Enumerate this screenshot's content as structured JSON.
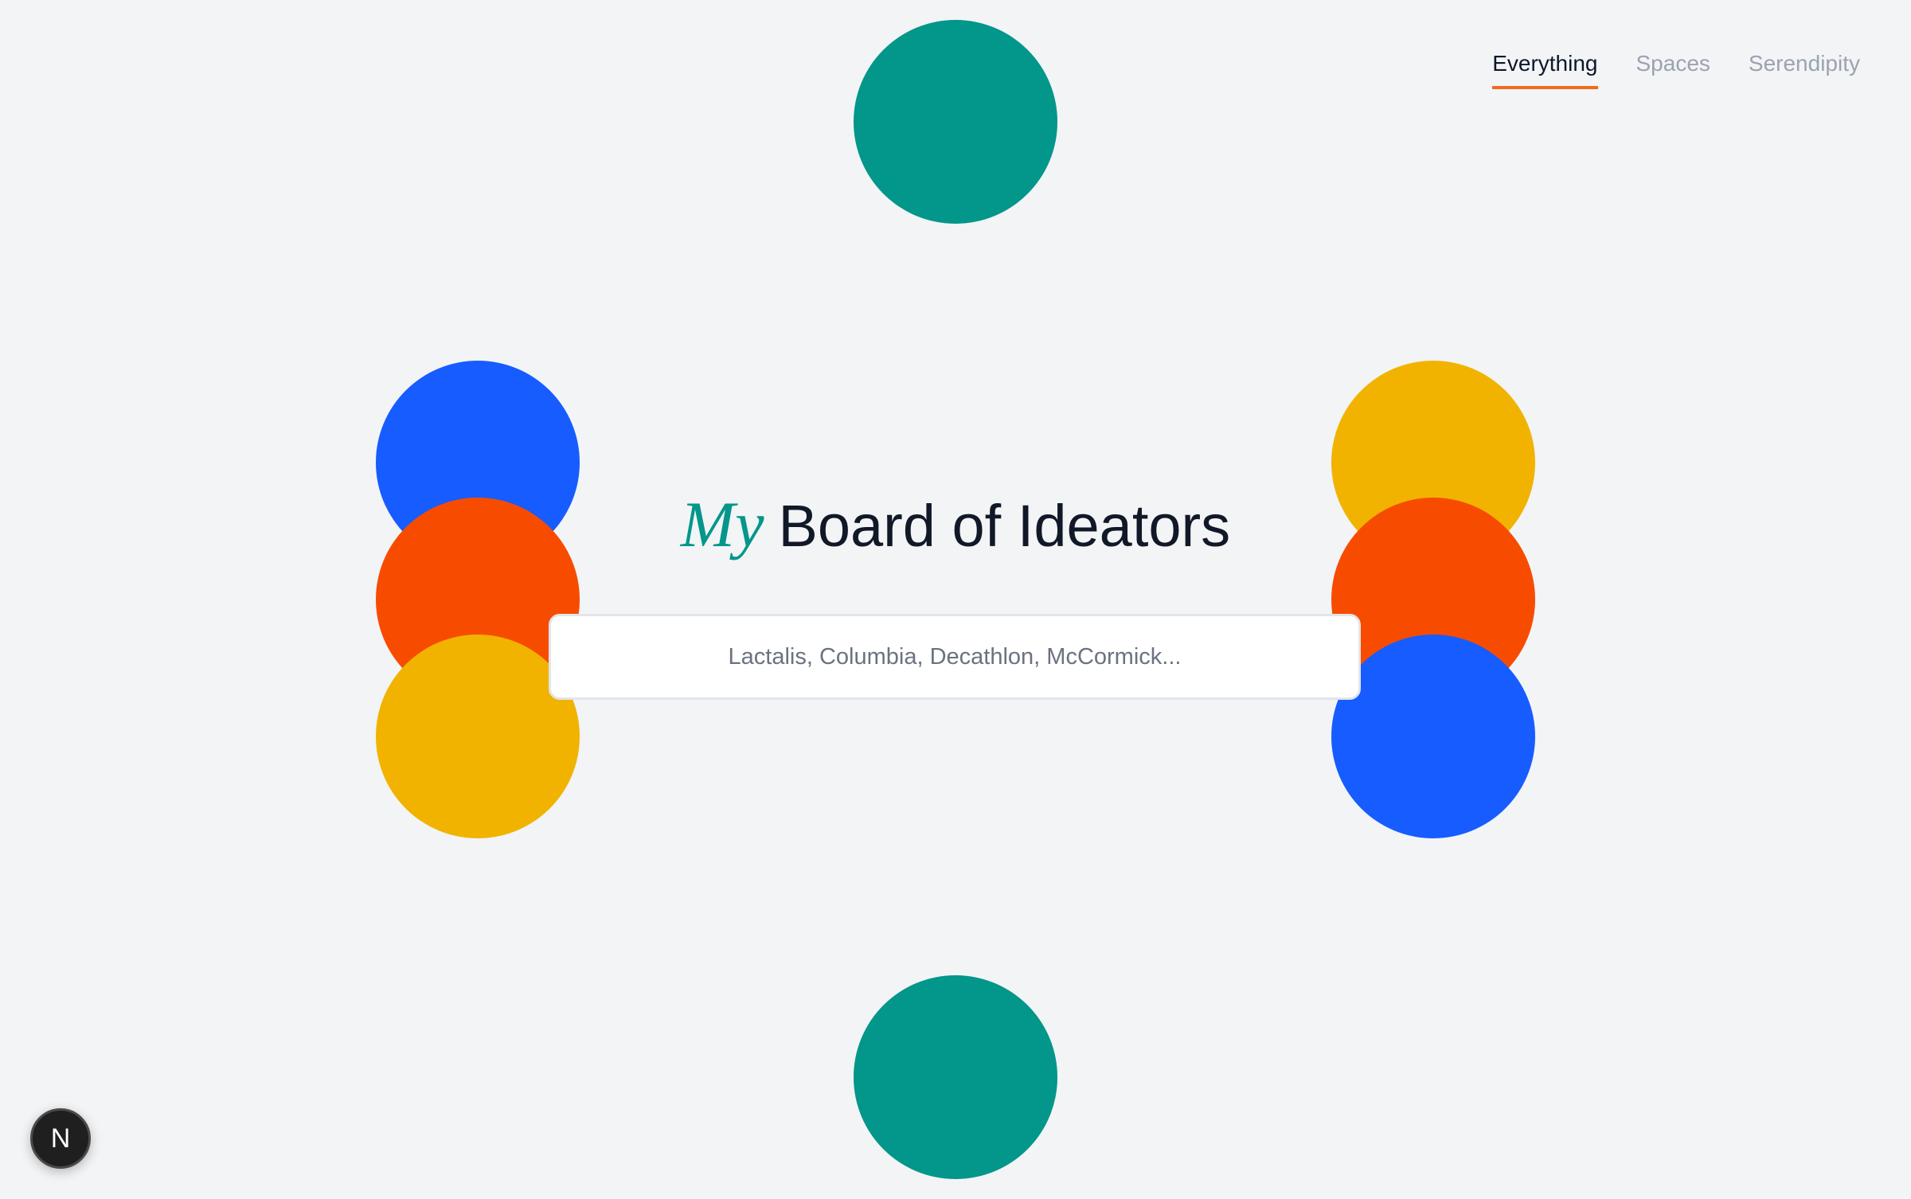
{
  "nav": {
    "tabs": [
      {
        "label": "Everything",
        "active": true
      },
      {
        "label": "Spaces",
        "active": false
      },
      {
        "label": "Serendipity",
        "active": false
      }
    ],
    "active_underline_color": "#f26a1b"
  },
  "headline": {
    "accent": "My",
    "title": "Board of Ideators",
    "accent_color": "#04968a"
  },
  "search": {
    "placeholder": "Lactalis, Columbia, Decathlon, McCormick..."
  },
  "decor": {
    "colors": {
      "teal": "#03968a",
      "blue": "#175cff",
      "red": "#f74c00",
      "yellow": "#f1b300"
    }
  },
  "dev_badge": {
    "label": "N"
  }
}
